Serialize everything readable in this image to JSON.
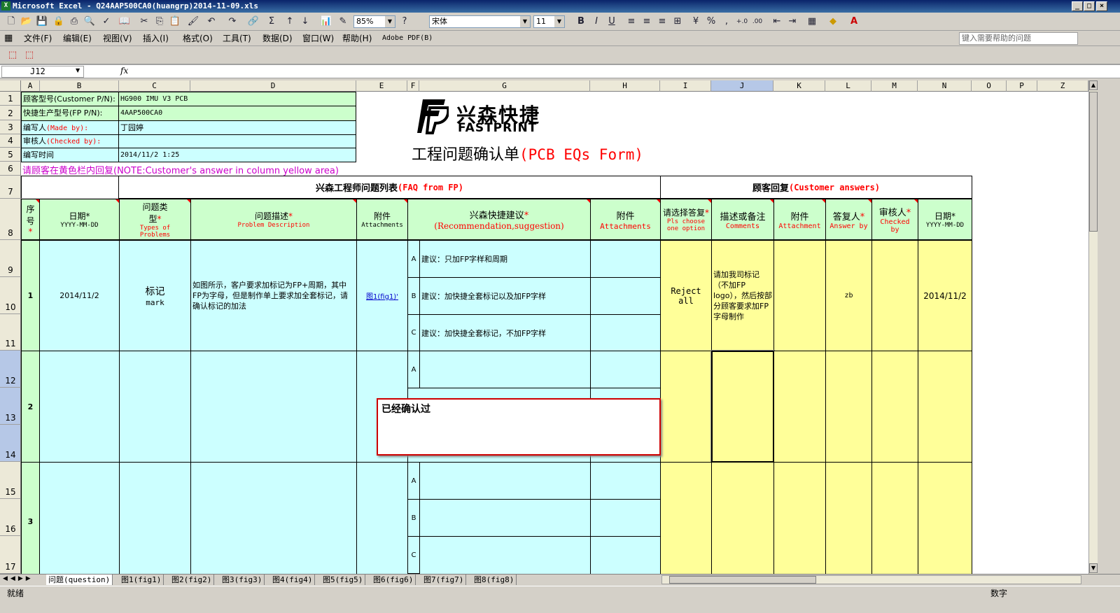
{
  "window": {
    "title": "Microsoft Excel - Q24AAP500CA0(huangrp)2014-11-09.xls",
    "buttons": [
      "_",
      "□",
      "×"
    ]
  },
  "toolbar": {
    "zoom": "85%",
    "font_name": "宋体",
    "font_size": "11"
  },
  "menu": {
    "items": [
      "文件(F)",
      "编辑(E)",
      "视图(V)",
      "插入(I)",
      "格式(O)",
      "工具(T)",
      "数据(D)",
      "窗口(W)",
      "帮助(H)",
      "Adobe PDF(B)"
    ],
    "help_placeholder": "键入需要帮助的问题"
  },
  "formula": {
    "name_box": "J12",
    "fx": "fx",
    "content": ""
  },
  "columns": [
    "A",
    "B",
    "C",
    "D",
    "E",
    "F",
    "G",
    "H",
    "I",
    "J",
    "K",
    "L",
    "M",
    "N",
    "O",
    "P",
    "Z"
  ],
  "rows": [
    "1",
    "2",
    "3",
    "4",
    "5",
    "6",
    "7",
    "8",
    "9",
    "10",
    "11",
    "12",
    "13",
    "14",
    "15",
    "16",
    "17"
  ],
  "header_info": {
    "r1_label": "顾客型号(Customer P/N):",
    "r1_value": "HG900 IMU V3 PCB",
    "r2_label": "快捷生产型号(FP P/N):",
    "r2_value": "4AAP500CA0",
    "r3_label": "编写人",
    "r3_label_en": "(Made by):",
    "r3_value": "丁园婷",
    "r4_label": "审核人",
    "r4_label_en": "(Checked by):",
    "r4_value": "",
    "r5_label": "编写时间",
    "r5_value": "2014/11/2 1:25",
    "note_cn": "请顾客在黄色栏内回复",
    "note_en": "(NOTE:Customer's answer in column yellow area)"
  },
  "logo": {
    "cn": "兴森快捷",
    "en": "FASTPRINT"
  },
  "form_title": {
    "cn": "工程问题确认单",
    "en": "(PCB EQs Form)"
  },
  "section": {
    "fp_cn": "兴森工程师问题列表",
    "fp_en": "(FAQ from FP)",
    "cust_cn": "顾客回复",
    "cust_en": "(Customer answers)"
  },
  "col_headers": {
    "seq": "序号",
    "date": "日期",
    "date_fmt": "YYYY-MM-DD",
    "type": "问题类型",
    "type_en": "Types of Problems",
    "desc": "问题描述",
    "desc_en": "Problem Description",
    "attach": "附件",
    "attach_en": "Attachments",
    "rec": "兴森快捷建议",
    "rec_en": "(Recommendation,suggestion)",
    "attach2": "附件",
    "attach2_en": "Attachments",
    "choose": "请选择答复",
    "choose_en": "Pls choose one option",
    "comments": "描述或备注",
    "comments_en": "Comments",
    "attach3": "附件",
    "attach3_en": "Attachment",
    "answer": "答复人",
    "answer_en": "Answer by",
    "checked": "审核人",
    "checked_en": "Checked by",
    "date2": "日期",
    "date2_fmt": "YYYY-MM-DD"
  },
  "questions": [
    {
      "seq": "1",
      "date": "2014/11/2",
      "type_cn": "标记",
      "type_en": "mark",
      "desc": "如图所示，客户要求加标记为FP+周期，其中FP为字母，但是制作单上要求加全套标记，请确认标记的加法",
      "attach": "图1(fig1)'",
      "options": [
        {
          "letter": "A",
          "text": "建议：只加FP字样和周期"
        },
        {
          "letter": "B",
          "text": "建议：加快捷全套标记以及加FP字样"
        },
        {
          "letter": "C",
          "text": "建议：加快捷全套标记，不加FP字样"
        }
      ],
      "choose": "Reject all",
      "comments": "请加我司标记（不加FP logo），然后按部分顾客要求加FP字母制作",
      "answer_by": "zb",
      "date2": "2014/11/2"
    },
    {
      "seq": "2",
      "options": [
        {
          "letter": "A",
          "text": ""
        }
      ]
    },
    {
      "seq": "3",
      "options": [
        {
          "letter": "A",
          "text": ""
        },
        {
          "letter": "B",
          "text": ""
        },
        {
          "letter": "C",
          "text": ""
        }
      ]
    }
  ],
  "comment_box": "已经确认过",
  "sheet_tabs": [
    "问题(question)",
    "图1(fig1)",
    "图2(fig2)",
    "图3(fig3)",
    "图4(fig4)",
    "图5(fig5)",
    "图6(fig6)",
    "图7(fig7)",
    "图8(fig8)"
  ],
  "status": {
    "left": "就绪",
    "right": "数字"
  }
}
